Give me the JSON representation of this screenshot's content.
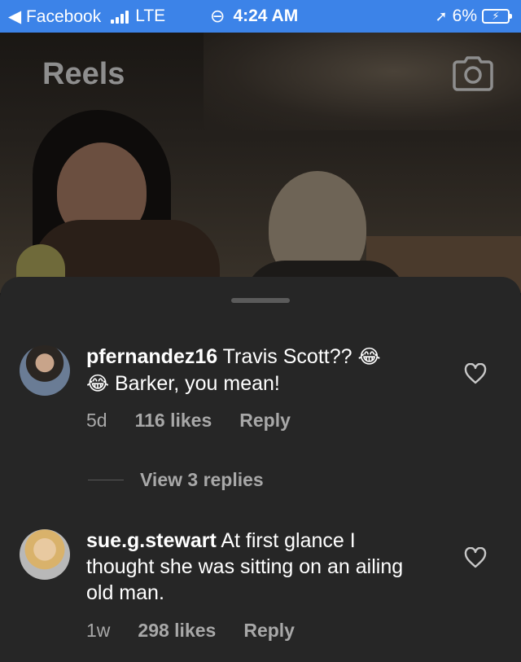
{
  "status_bar": {
    "back_label": "◀ Facebook",
    "network": "LTE",
    "time": "4:24 AM",
    "battery": "6%"
  },
  "header": {
    "title": "Reels",
    "camera_icon": "camera-icon"
  },
  "comments": [
    {
      "username": "pfernandez16",
      "text_a": "Travis Scott??",
      "emoji_a": "😂",
      "emoji_b": "😂",
      "text_b": "Barker, you mean!",
      "time_ago": "5d",
      "likes": "116 likes",
      "reply": "Reply",
      "view_replies": "View 3 replies"
    },
    {
      "username": "sue.g.stewart",
      "text": "At first glance I thought she was sitting on an ailing old man.",
      "time_ago": "1w",
      "likes": "298 likes",
      "reply": "Reply"
    }
  ],
  "colors": {
    "status_bar": "#3c83e8",
    "sheet": "#262626",
    "muted_text": "#a8a8a8"
  }
}
